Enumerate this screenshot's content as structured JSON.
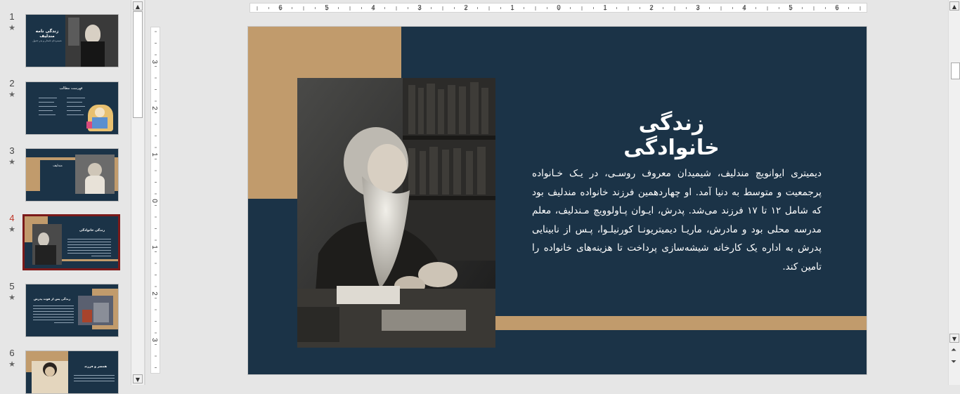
{
  "thumbnails": [
    {
      "number": "1",
      "star": "★",
      "title": "زندگی نامه مندلیف",
      "subtitle": "شیمی‌دان نامدار و پدر جدول"
    },
    {
      "number": "2",
      "star": "★",
      "title": "فهرست مطالب"
    },
    {
      "number": "3",
      "star": "★",
      "title": "مندلیف"
    },
    {
      "number": "4",
      "star": "★",
      "title": "زندگی خانوادگی"
    },
    {
      "number": "5",
      "star": "★",
      "title": "زندگی پس از فوت پدرش"
    },
    {
      "number": "6",
      "star": "★",
      "title": "همسر و فرزند"
    }
  ],
  "active_slide": "4",
  "ruler": {
    "horizontal": [
      "6",
      "5",
      "4",
      "3",
      "2",
      "1",
      "0",
      "1",
      "2",
      "3",
      "4",
      "5",
      "6"
    ],
    "vertical": [
      "3",
      "2",
      "1",
      "0",
      "1",
      "2",
      "3"
    ]
  },
  "slide": {
    "title": "زندگی خانوادگی",
    "body": "دیمیتری ایوانویچ مندلیف، شیمیدان معروف روسـی، در یـک خـانواده پرجمعیت و متوسط به دنیا آمد. او چهاردهمین فرزند خانواده مندلیف بود که شامل ۱۲ تا ۱۷ فرزند می‌شد. پدرش، ایـوان پـاولوویچ مـندلیف، معلم مدرسه محلی بود و مادرش، ماریـا دیمیتریونـا کورنیلـوا، پـس از نابینایی پدرش به اداره یک کارخانه شیشه‌سازی پرداخت تا هزینه‌های خانواده را تامین کند."
  },
  "colors": {
    "slide_background": "#1b3347",
    "accent_tan": "#c19b6c",
    "active_thumbnail_border": "#7b1a1a",
    "active_number": "#c0392b"
  },
  "icons": {
    "scroll_up": "▲",
    "scroll_down": "▼",
    "prev_slide": "⏶",
    "next_slide": "⏷"
  }
}
